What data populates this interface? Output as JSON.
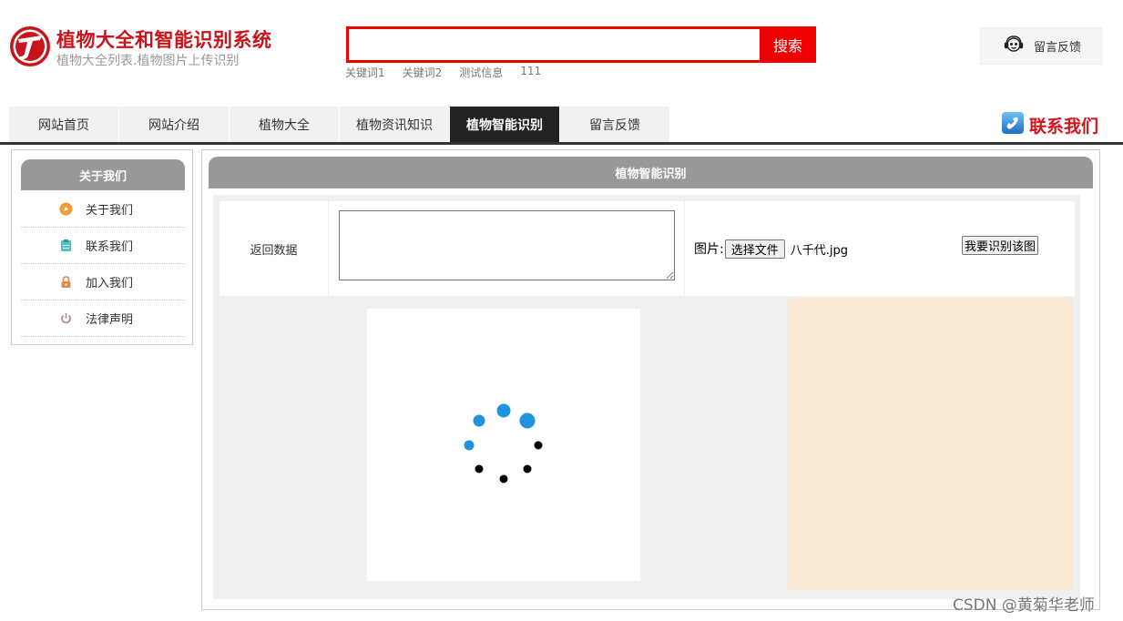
{
  "header": {
    "title": "植物大全和智能识别系统",
    "subtitle": "植物大全列表.植物图片上传识别",
    "search_placeholder": "",
    "search_button": "搜索",
    "keywords": [
      "关键词1",
      "关键词2",
      "测试信息",
      "111"
    ],
    "feedback_label": "留言反馈"
  },
  "nav": {
    "items": [
      {
        "label": "网站首页",
        "active": false
      },
      {
        "label": "网站介绍",
        "active": false
      },
      {
        "label": "植物大全",
        "active": false
      },
      {
        "label": "植物资讯知识",
        "active": false
      },
      {
        "label": "植物智能识别",
        "active": true
      },
      {
        "label": "留言反馈",
        "active": false
      }
    ],
    "contact_label": "联系我们"
  },
  "sidebar": {
    "title": "关于我们",
    "items": [
      {
        "label": "关于我们",
        "icon": "orange-circle-icon",
        "color": "#f39c3c"
      },
      {
        "label": "联系我们",
        "icon": "clipboard-icon",
        "color": "#4cc3c9"
      },
      {
        "label": "加入我们",
        "icon": "lock-icon",
        "color": "#e0874a"
      },
      {
        "label": "法律声明",
        "icon": "power-icon",
        "color": "#b58a8a"
      }
    ]
  },
  "main": {
    "title": "植物智能识别",
    "return_label": "返回数据",
    "textarea_value": "",
    "image_label": "图片:",
    "file_button": "选择文件",
    "file_name": "八千代.jpg",
    "recognize_button": "我要识别该图"
  },
  "colors": {
    "brand_red": "#c8141a",
    "search_red": "#ee0000",
    "spinner_blue": "#1f94dd",
    "result_bg": "#faebd7"
  },
  "watermark": "CSDN @黄菊华老师"
}
